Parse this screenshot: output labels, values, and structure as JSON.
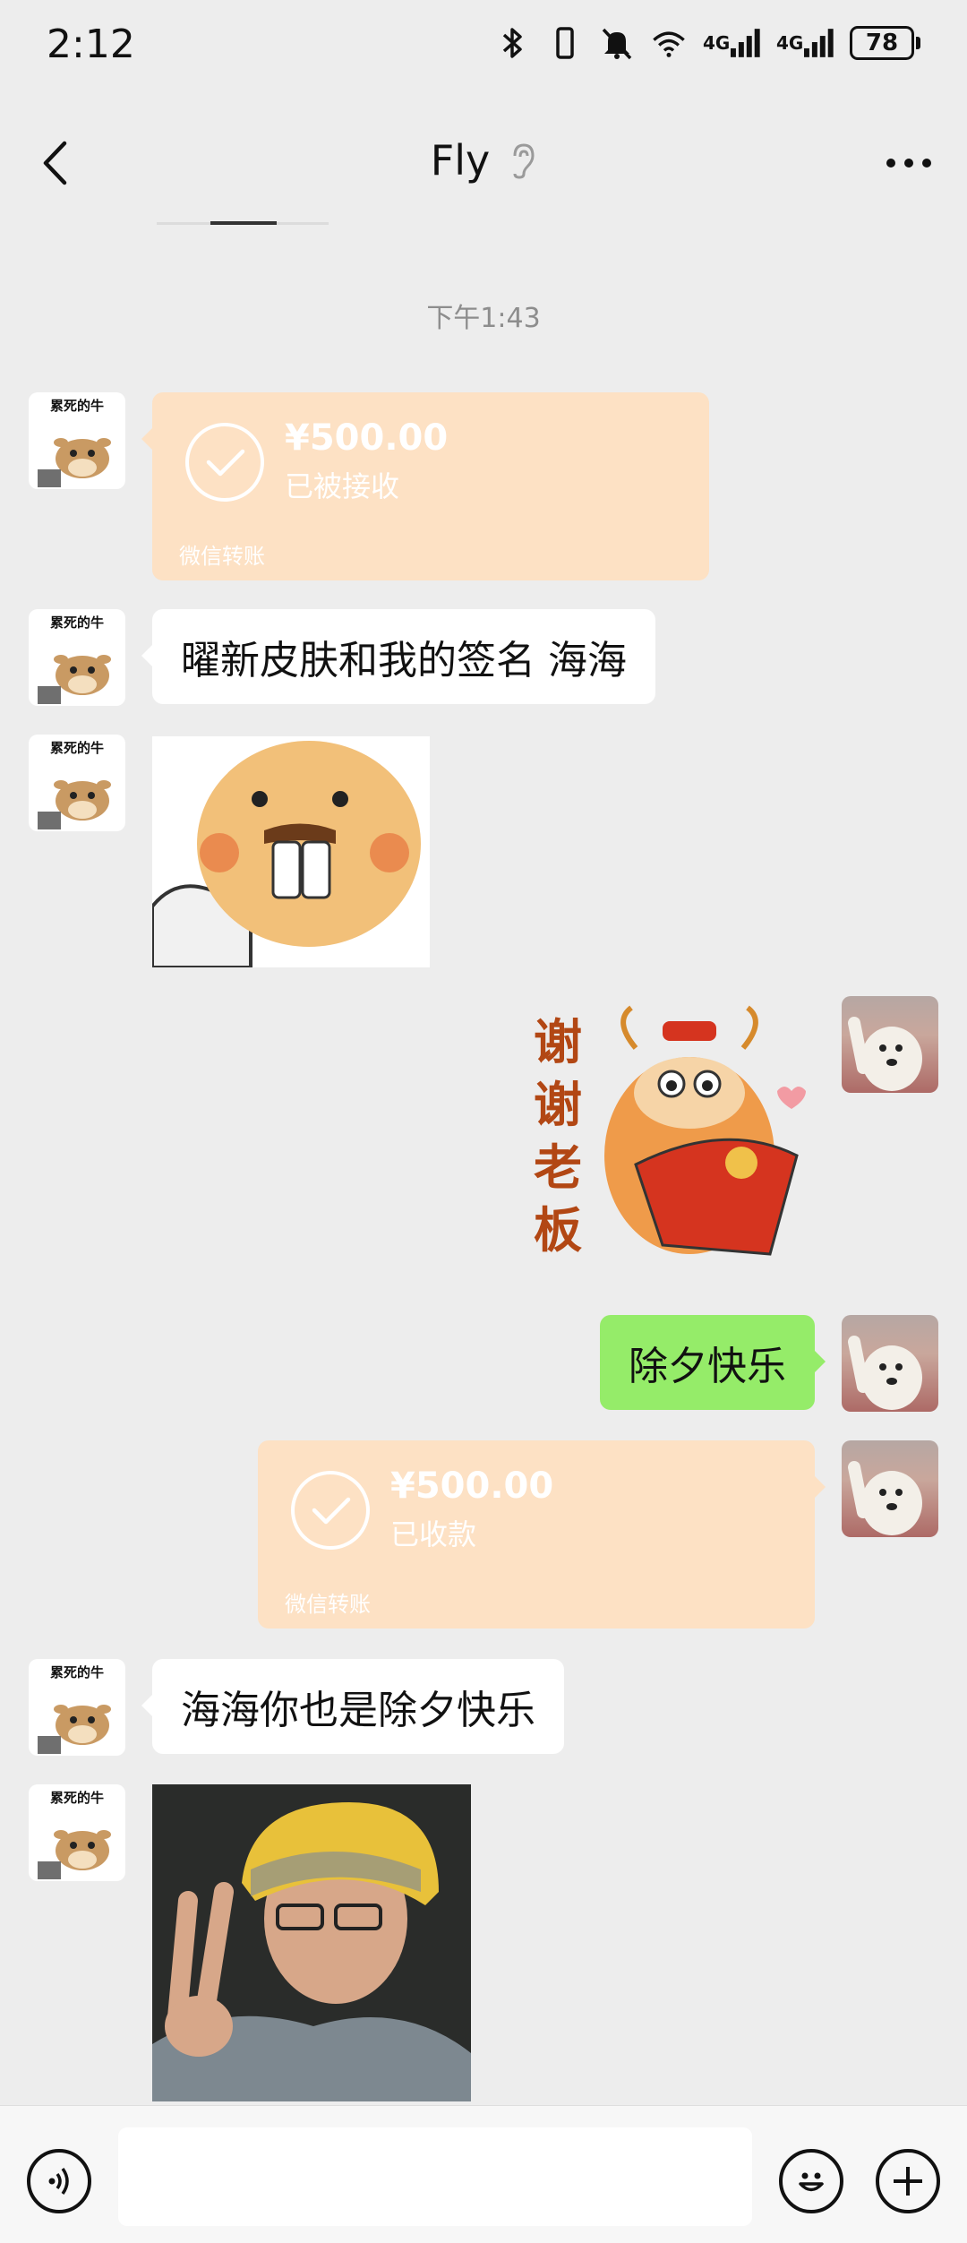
{
  "status_bar": {
    "time": "2:12",
    "network_1": "4G",
    "network_2": "4G",
    "battery": "78",
    "icons": [
      "bluetooth-icon",
      "vibrate-icon",
      "mute-icon",
      "wifi-icon",
      "signal-icon",
      "signal-icon",
      "battery-icon"
    ]
  },
  "header": {
    "title": "Fly",
    "back_icon": "chevron-left-icon",
    "earpiece_icon": "ear-icon",
    "more_icon": "more-dots-icon"
  },
  "chat": {
    "timestamp": "下午1:43",
    "sender_avatar_label": "累死的牛",
    "messages": [
      {
        "side": "left",
        "kind": "transfer",
        "amount": "¥500.00",
        "status": "已被接收",
        "footer": "微信转账"
      },
      {
        "side": "left",
        "kind": "text",
        "text": "曜新皮肤和我的签名 海海"
      },
      {
        "side": "left",
        "kind": "sticker",
        "image": "buck-tooth-face-sticker"
      },
      {
        "side": "right",
        "kind": "sticker",
        "image": "ox-red-envelope-sticker",
        "sticker_text": "谢谢老板"
      },
      {
        "side": "right",
        "kind": "text",
        "text": "除夕快乐"
      },
      {
        "side": "right",
        "kind": "transfer",
        "amount": "¥500.00",
        "status": "已收款",
        "footer": "微信转账"
      },
      {
        "side": "left",
        "kind": "text",
        "text": "海海你也是除夕快乐"
      },
      {
        "side": "left",
        "kind": "image",
        "image": "helmet-man-peace-sign-photo"
      }
    ]
  },
  "input_bar": {
    "voice_icon": "voice-icon",
    "emoji_icon": "emoji-icon",
    "plus_icon": "plus-icon"
  },
  "colors": {
    "background": "#ededed",
    "sent_bubble": "#95ec69",
    "received_bubble": "#ffffff",
    "transfer_bubble": "#fde1c4"
  }
}
